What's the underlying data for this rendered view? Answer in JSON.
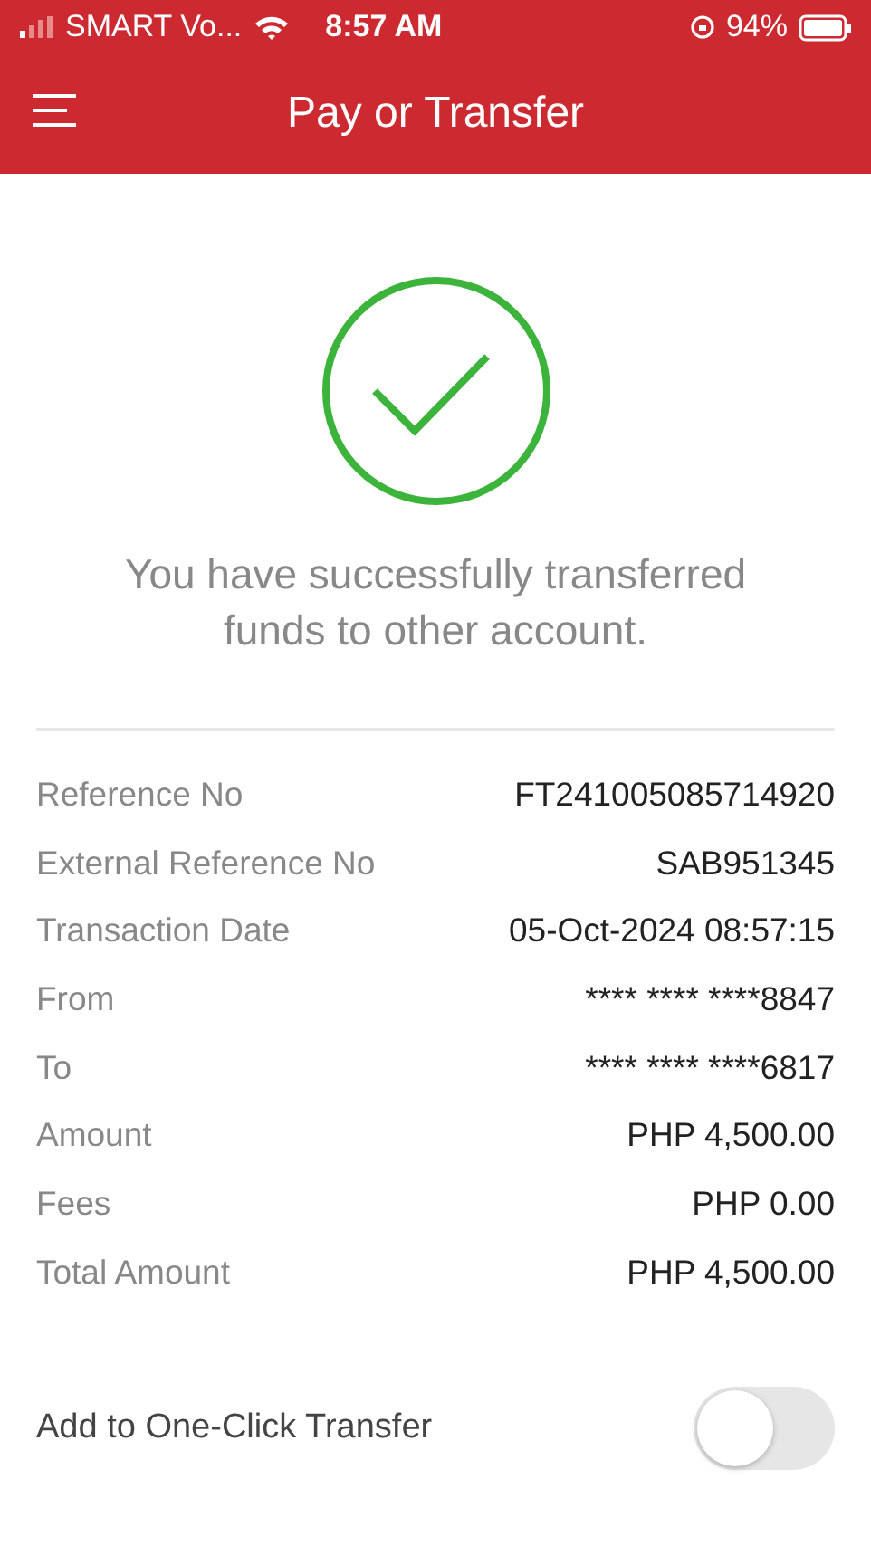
{
  "status_bar": {
    "carrier": "SMART Vo...",
    "time": "8:57 AM",
    "battery": "94%"
  },
  "header": {
    "title": "Pay or Transfer"
  },
  "message": "You have successfully transferred funds to other account.",
  "details": [
    {
      "label": "Reference No",
      "value": "FT241005085714920"
    },
    {
      "label": "External Reference No",
      "value": "SAB951345"
    },
    {
      "label": "Transaction Date",
      "value": "05-Oct-2024 08:57:15"
    },
    {
      "label": "From",
      "value": "**** **** ****8847"
    },
    {
      "label": "To",
      "value": "**** **** ****6817"
    },
    {
      "label": "Amount",
      "value": "PHP 4,500.00"
    },
    {
      "label": "Fees",
      "value": "PHP 0.00"
    },
    {
      "label": "Total Amount",
      "value": "PHP 4,500.00"
    }
  ],
  "one_click": {
    "label": "Add to One-Click Transfer",
    "on": false
  }
}
